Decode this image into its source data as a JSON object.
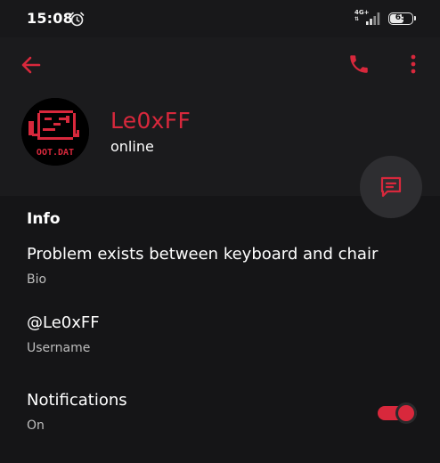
{
  "status_bar": {
    "time": "15:08",
    "network": "4G+",
    "battery": "65",
    "battery_level": 0.65,
    "icons": [
      "alarm-icon",
      "signal-icon",
      "battery-icon"
    ]
  },
  "toolbar": {
    "icons": [
      "back-arrow-icon",
      "phone-icon",
      "more-vertical-icon"
    ]
  },
  "profile": {
    "name": "Le0xFF",
    "status": "online",
    "avatar_text": "OOT.DAT"
  },
  "fab": {
    "icon": "message-icon"
  },
  "info": {
    "title": "Info",
    "bio": {
      "value": "Problem exists between keyboard and chair",
      "caption": "Bio"
    },
    "username": {
      "value": "@Le0xFF",
      "caption": "Username"
    },
    "notifications": {
      "value": "Notifications",
      "caption": "On",
      "enabled": true
    }
  },
  "colors": {
    "accent": "#d8283c",
    "background": "#151517",
    "header": "#1b1b1d",
    "fab": "#2e2e31",
    "secondary_text": "#bdbdbd"
  }
}
